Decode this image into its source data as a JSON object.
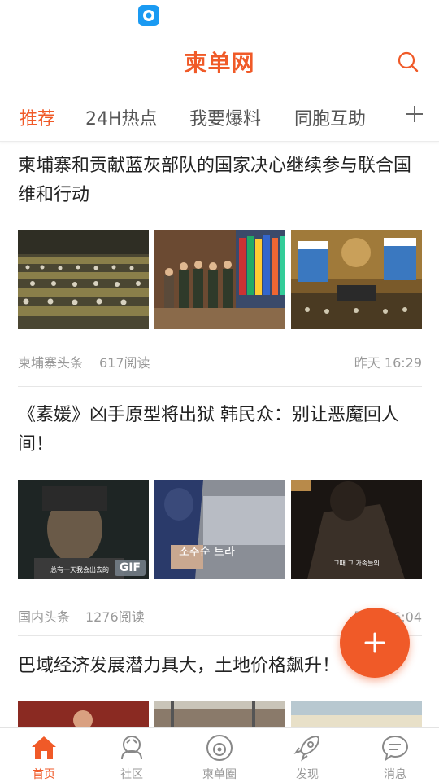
{
  "app": {
    "title": "柬单网",
    "accent_color": "#f05a28"
  },
  "tabs": [
    {
      "label": "推荐",
      "active": true
    },
    {
      "label": "24H热点",
      "active": false
    },
    {
      "label": "我要爆料",
      "active": false
    },
    {
      "label": "同胞互助",
      "active": false
    }
  ],
  "articles": [
    {
      "title": "柬埔寨和贡献蓝灰部队的国家决心继续参与联合国维和行动",
      "source": "柬埔寨头条",
      "reads": "617阅读",
      "time": "昨天 16:29"
    },
    {
      "title": "《素媛》凶手原型将出狱 韩民众：别让恶魔回人间！",
      "source": "国内头条",
      "reads": "1276阅读",
      "time": "昨天 16:04",
      "gif_badge": "GIF"
    },
    {
      "title": "巴域经济发展潜力具大，土地价格飙升！"
    }
  ],
  "nav": [
    {
      "label": "首页",
      "icon": "home-icon",
      "active": true
    },
    {
      "label": "社区",
      "icon": "community-icon",
      "active": false
    },
    {
      "label": "柬单圈",
      "icon": "circle-icon",
      "active": false
    },
    {
      "label": "发现",
      "icon": "rocket-icon",
      "active": false
    },
    {
      "label": "消息",
      "icon": "message-icon",
      "active": false
    }
  ]
}
